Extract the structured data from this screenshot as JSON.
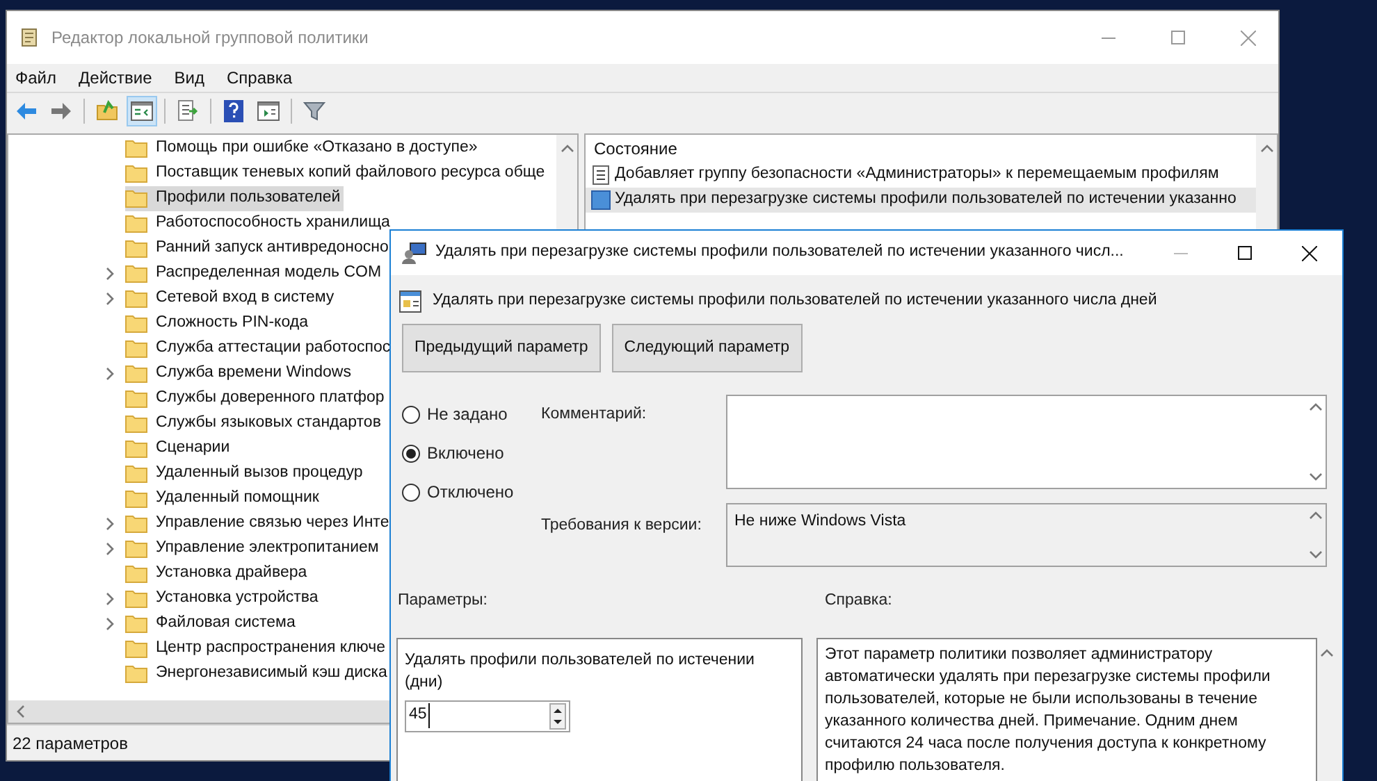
{
  "window": {
    "title": "Редактор локальной групповой политики"
  },
  "menu": [
    "Файл",
    "Действие",
    "Вид",
    "Справка"
  ],
  "toolbar": [
    {
      "kind": "back",
      "pressed": false
    },
    {
      "kind": "forward",
      "pressed": false
    },
    {
      "kind": "sep"
    },
    {
      "kind": "up",
      "pressed": false
    },
    {
      "kind": "tree",
      "pressed": true
    },
    {
      "kind": "sep"
    },
    {
      "kind": "export",
      "pressed": false
    },
    {
      "kind": "sep"
    },
    {
      "kind": "help",
      "pressed": false
    },
    {
      "kind": "props",
      "pressed": false
    },
    {
      "kind": "sep"
    },
    {
      "kind": "filter",
      "pressed": false
    }
  ],
  "tree": [
    {
      "label": "Помощь при ошибке «Отказано в доступе»",
      "expandable": false,
      "selected": false
    },
    {
      "label": "Поставщик теневых копий файлового ресурса обще",
      "expandable": false,
      "selected": false
    },
    {
      "label": "Профили пользователей",
      "expandable": false,
      "selected": true
    },
    {
      "label": "Работоспособность хранилища",
      "expandable": false,
      "selected": false
    },
    {
      "label": "Ранний запуск антивредоносно",
      "expandable": false,
      "selected": false
    },
    {
      "label": "Распределенная модель COM",
      "expandable": true,
      "selected": false
    },
    {
      "label": "Сетевой вход в систему",
      "expandable": true,
      "selected": false
    },
    {
      "label": "Сложность PIN-кода",
      "expandable": false,
      "selected": false
    },
    {
      "label": "Служба аттестации работоспос",
      "expandable": false,
      "selected": false
    },
    {
      "label": "Служба времени Windows",
      "expandable": true,
      "selected": false
    },
    {
      "label": "Службы доверенного платфор",
      "expandable": false,
      "selected": false
    },
    {
      "label": "Службы языковых стандартов",
      "expandable": false,
      "selected": false
    },
    {
      "label": "Сценарии",
      "expandable": false,
      "selected": false
    },
    {
      "label": "Удаленный вызов процедур",
      "expandable": false,
      "selected": false
    },
    {
      "label": "Удаленный помощник",
      "expandable": false,
      "selected": false
    },
    {
      "label": "Управление связью через Инте",
      "expandable": true,
      "selected": false
    },
    {
      "label": "Управление электропитанием",
      "expandable": true,
      "selected": false
    },
    {
      "label": "Установка драйвера",
      "expandable": false,
      "selected": false
    },
    {
      "label": "Установка устройства",
      "expandable": true,
      "selected": false
    },
    {
      "label": "Файловая система",
      "expandable": true,
      "selected": false
    },
    {
      "label": "Центр распространения ключе",
      "expandable": false,
      "selected": false
    },
    {
      "label": "Энергонезависимый кэш диска",
      "expandable": false,
      "selected": false
    }
  ],
  "status_bar": "22 параметров",
  "list": {
    "column": "Состояние",
    "rows": [
      {
        "label": "Добавляет группу безопасности «Администраторы» к перемещаемым профилям",
        "selected": false
      },
      {
        "label": "Удалять при перезагрузке системы профили пользователей по истечении указанно",
        "selected": true
      }
    ]
  },
  "dialog": {
    "title": "Удалять при перезагрузке системы профили пользователей по истечении указанного числ...",
    "heading": "Удалять при перезагрузке системы профили пользователей по истечении указанного числа дней",
    "buttons": [
      "Предыдущий параметр",
      "Следующий параметр"
    ],
    "radios": [
      {
        "label": "Не задано",
        "selected": false
      },
      {
        "label": "Включено",
        "selected": true
      },
      {
        "label": "Отключено",
        "selected": false
      }
    ],
    "comment_label": "Комментарий:",
    "requirements_label": "Требования к версии:",
    "requirements": "Не ниже Windows Vista",
    "options_label": "Параметры:",
    "help_label": "Справка:",
    "option": {
      "label": "Удалять профили пользователей по истечении (дни)",
      "value": "45"
    },
    "help": "Этот параметр политики позволяет администратору автоматически удалять при перезагрузке системы профили пользователей, которые не были использованы в течение указанного количества дней. Примечание. Одним днем считаются 24 часа после получения доступа к конкретному профилю пользователя."
  }
}
